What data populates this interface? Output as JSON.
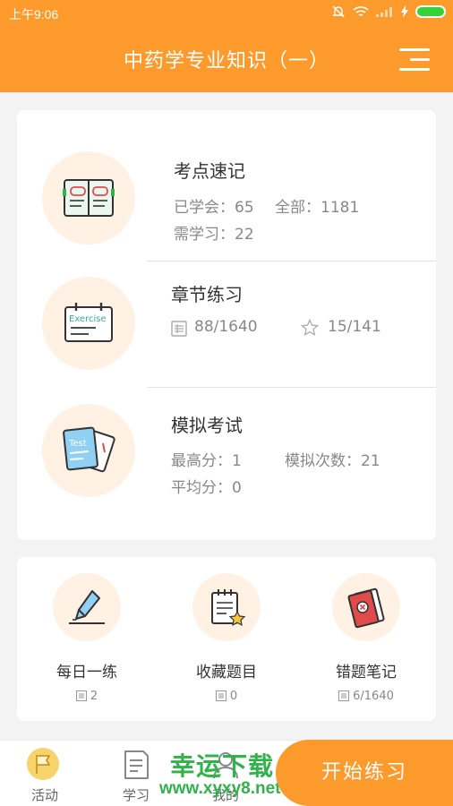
{
  "status_bar": {
    "time": "上午9:06"
  },
  "header": {
    "title": "中药学专业知识（一）",
    "menu_icon": "menu-icon"
  },
  "sections": [
    {
      "title": "考点速记",
      "icon": "flashcard-book-icon",
      "stats": [
        "已学会：65",
        "全部：1181",
        "需学习：22"
      ]
    },
    {
      "title": "章节练习",
      "icon": "exercise-calendar-icon",
      "icon_text": "Exercise",
      "stats": [
        "88/1640",
        "15/141"
      ]
    },
    {
      "title": "模拟考试",
      "icon": "test-papers-icon",
      "icon_text": "Test",
      "stats": [
        "最高分：1",
        "模拟次数：21",
        "平均分：0"
      ]
    }
  ],
  "tools": [
    {
      "label": "每日一练",
      "count": "2",
      "icon": "pen-icon"
    },
    {
      "label": "收藏题目",
      "count": "0",
      "icon": "notepad-star-icon"
    },
    {
      "label": "错题笔记",
      "count": "6/1640",
      "icon": "error-notebook-icon"
    }
  ],
  "bottom_nav": {
    "items": [
      {
        "label": "活动",
        "icon": "flag-icon"
      },
      {
        "label": "学习",
        "icon": "document-icon"
      },
      {
        "label": "我的",
        "icon": "user-icon"
      }
    ],
    "start_button": "开始练习"
  },
  "watermark": {
    "cn": "幸运下载",
    "url": "www.xyxy8.net"
  },
  "colors": {
    "accent": "#fd9a2c",
    "icon_bg": "#fff1e3",
    "watermark": "#2fb34a"
  }
}
